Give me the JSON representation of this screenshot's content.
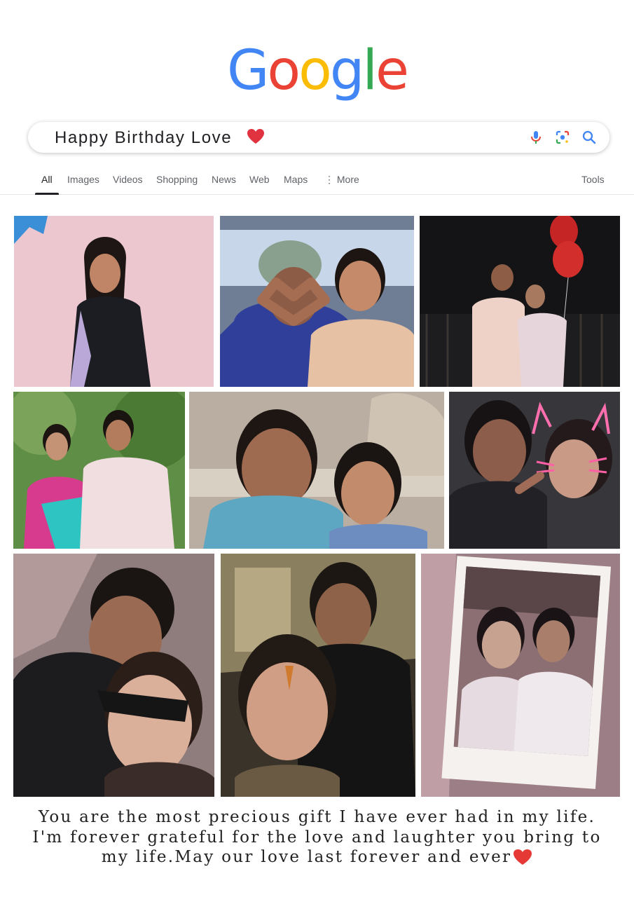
{
  "logo": {
    "letters": [
      "G",
      "o",
      "o",
      "g",
      "l",
      "e"
    ],
    "colors": [
      "#4285F4",
      "#EA4335",
      "#FBBC05",
      "#4285F4",
      "#34A853",
      "#EA4335"
    ]
  },
  "search": {
    "query": "Happy Birthday Love",
    "icons": [
      "heart-emoji",
      "mic-icon",
      "lens-icon",
      "search-icon"
    ]
  },
  "tabs": {
    "items": [
      "All",
      "Images",
      "Videos",
      "Shopping",
      "News",
      "Web",
      "Maps",
      "⋮ More"
    ],
    "tools": "Tools",
    "active": "All"
  },
  "gallery": {
    "photos": [
      {
        "name": "photo-woman-pink-wall"
      },
      {
        "name": "photo-couple-heart-hands"
      },
      {
        "name": "photo-couple-red-balloons"
      },
      {
        "name": "photo-couple-green-trees"
      },
      {
        "name": "photo-couple-selfie-palace"
      },
      {
        "name": "photo-couple-cat-filter"
      },
      {
        "name": "photo-couple-sunglasses-selfie"
      },
      {
        "name": "photo-couple-temple-night"
      },
      {
        "name": "photo-couple-polaroid-frame"
      }
    ]
  },
  "message": {
    "line1": "You are the most precious gift I have ever had in my life.",
    "line2": "I'm forever grateful for the love and laughter you bring to",
    "line3": "my life.May our love last forever and ever",
    "heart_color": "#e53935"
  }
}
